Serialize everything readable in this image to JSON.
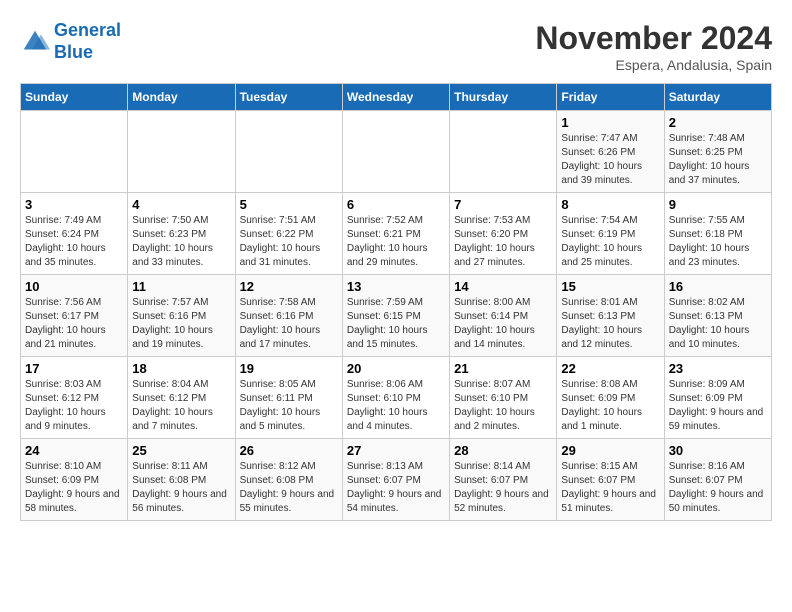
{
  "header": {
    "logo_line1": "General",
    "logo_line2": "Blue",
    "month_title": "November 2024",
    "location": "Espera, Andalusia, Spain"
  },
  "days_of_week": [
    "Sunday",
    "Monday",
    "Tuesday",
    "Wednesday",
    "Thursday",
    "Friday",
    "Saturday"
  ],
  "weeks": [
    [
      {
        "day": "",
        "info": ""
      },
      {
        "day": "",
        "info": ""
      },
      {
        "day": "",
        "info": ""
      },
      {
        "day": "",
        "info": ""
      },
      {
        "day": "",
        "info": ""
      },
      {
        "day": "1",
        "info": "Sunrise: 7:47 AM\nSunset: 6:26 PM\nDaylight: 10 hours and 39 minutes."
      },
      {
        "day": "2",
        "info": "Sunrise: 7:48 AM\nSunset: 6:25 PM\nDaylight: 10 hours and 37 minutes."
      }
    ],
    [
      {
        "day": "3",
        "info": "Sunrise: 7:49 AM\nSunset: 6:24 PM\nDaylight: 10 hours and 35 minutes."
      },
      {
        "day": "4",
        "info": "Sunrise: 7:50 AM\nSunset: 6:23 PM\nDaylight: 10 hours and 33 minutes."
      },
      {
        "day": "5",
        "info": "Sunrise: 7:51 AM\nSunset: 6:22 PM\nDaylight: 10 hours and 31 minutes."
      },
      {
        "day": "6",
        "info": "Sunrise: 7:52 AM\nSunset: 6:21 PM\nDaylight: 10 hours and 29 minutes."
      },
      {
        "day": "7",
        "info": "Sunrise: 7:53 AM\nSunset: 6:20 PM\nDaylight: 10 hours and 27 minutes."
      },
      {
        "day": "8",
        "info": "Sunrise: 7:54 AM\nSunset: 6:19 PM\nDaylight: 10 hours and 25 minutes."
      },
      {
        "day": "9",
        "info": "Sunrise: 7:55 AM\nSunset: 6:18 PM\nDaylight: 10 hours and 23 minutes."
      }
    ],
    [
      {
        "day": "10",
        "info": "Sunrise: 7:56 AM\nSunset: 6:17 PM\nDaylight: 10 hours and 21 minutes."
      },
      {
        "day": "11",
        "info": "Sunrise: 7:57 AM\nSunset: 6:16 PM\nDaylight: 10 hours and 19 minutes."
      },
      {
        "day": "12",
        "info": "Sunrise: 7:58 AM\nSunset: 6:16 PM\nDaylight: 10 hours and 17 minutes."
      },
      {
        "day": "13",
        "info": "Sunrise: 7:59 AM\nSunset: 6:15 PM\nDaylight: 10 hours and 15 minutes."
      },
      {
        "day": "14",
        "info": "Sunrise: 8:00 AM\nSunset: 6:14 PM\nDaylight: 10 hours and 14 minutes."
      },
      {
        "day": "15",
        "info": "Sunrise: 8:01 AM\nSunset: 6:13 PM\nDaylight: 10 hours and 12 minutes."
      },
      {
        "day": "16",
        "info": "Sunrise: 8:02 AM\nSunset: 6:13 PM\nDaylight: 10 hours and 10 minutes."
      }
    ],
    [
      {
        "day": "17",
        "info": "Sunrise: 8:03 AM\nSunset: 6:12 PM\nDaylight: 10 hours and 9 minutes."
      },
      {
        "day": "18",
        "info": "Sunrise: 8:04 AM\nSunset: 6:12 PM\nDaylight: 10 hours and 7 minutes."
      },
      {
        "day": "19",
        "info": "Sunrise: 8:05 AM\nSunset: 6:11 PM\nDaylight: 10 hours and 5 minutes."
      },
      {
        "day": "20",
        "info": "Sunrise: 8:06 AM\nSunset: 6:10 PM\nDaylight: 10 hours and 4 minutes."
      },
      {
        "day": "21",
        "info": "Sunrise: 8:07 AM\nSunset: 6:10 PM\nDaylight: 10 hours and 2 minutes."
      },
      {
        "day": "22",
        "info": "Sunrise: 8:08 AM\nSunset: 6:09 PM\nDaylight: 10 hours and 1 minute."
      },
      {
        "day": "23",
        "info": "Sunrise: 8:09 AM\nSunset: 6:09 PM\nDaylight: 9 hours and 59 minutes."
      }
    ],
    [
      {
        "day": "24",
        "info": "Sunrise: 8:10 AM\nSunset: 6:09 PM\nDaylight: 9 hours and 58 minutes."
      },
      {
        "day": "25",
        "info": "Sunrise: 8:11 AM\nSunset: 6:08 PM\nDaylight: 9 hours and 56 minutes."
      },
      {
        "day": "26",
        "info": "Sunrise: 8:12 AM\nSunset: 6:08 PM\nDaylight: 9 hours and 55 minutes."
      },
      {
        "day": "27",
        "info": "Sunrise: 8:13 AM\nSunset: 6:07 PM\nDaylight: 9 hours and 54 minutes."
      },
      {
        "day": "28",
        "info": "Sunrise: 8:14 AM\nSunset: 6:07 PM\nDaylight: 9 hours and 52 minutes."
      },
      {
        "day": "29",
        "info": "Sunrise: 8:15 AM\nSunset: 6:07 PM\nDaylight: 9 hours and 51 minutes."
      },
      {
        "day": "30",
        "info": "Sunrise: 8:16 AM\nSunset: 6:07 PM\nDaylight: 9 hours and 50 minutes."
      }
    ]
  ]
}
